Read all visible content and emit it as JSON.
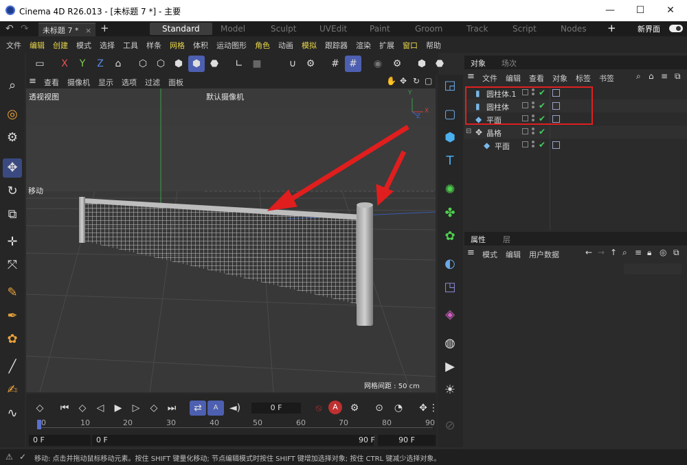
{
  "window": {
    "title": "Cinema 4D R26.013 - [未标题 7 *] - 主要",
    "btn_minimize": "—",
    "btn_maximize": "☐",
    "btn_close": "✕"
  },
  "tabbar": {
    "doc_tab": "未标题 7 *",
    "doc_close": "×",
    "new_tab": "+",
    "layouts": [
      "Standard",
      "Model",
      "Sculpt",
      "UVEdit",
      "Paint",
      "Groom",
      "Track",
      "Script",
      "Nodes"
    ],
    "active_layout": "Standard",
    "add_layout": "+",
    "new_interface": "新界面"
  },
  "menubar": {
    "items": [
      "文件",
      "编辑",
      "创建",
      "模式",
      "选择",
      "工具",
      "样条",
      "网格",
      "体积",
      "运动图形",
      "角色",
      "动画",
      "模拟",
      "跟踪器",
      "渲染",
      "扩展",
      "窗口",
      "帮助"
    ],
    "highlighted": [
      "编辑",
      "创建",
      "网格",
      "角色",
      "模拟",
      "窗口"
    ]
  },
  "toolbar": {
    "x_label": "X",
    "y_label": "Y",
    "z_label": "Z"
  },
  "viewport": {
    "menu": [
      "查看",
      "摄像机",
      "显示",
      "选项",
      "过滤",
      "面板"
    ],
    "view_name": "透视视图",
    "camera_name": "默认摄像机",
    "move_label": "移动",
    "grid_spacing": "网格间距 : 50 cm",
    "axis_y": "Y",
    "axis_x": "X",
    "axis_z": "Z"
  },
  "timeline": {
    "current_frame": "0 F",
    "ticks": [
      "0",
      "10",
      "20",
      "30",
      "40",
      "50",
      "60",
      "70",
      "80",
      "90"
    ],
    "start_field": "0 F",
    "min_field": "0 F",
    "end_field": "90 F",
    "max_field": "90 F",
    "autokey_label": "A"
  },
  "object_manager": {
    "tabs": [
      "对象",
      "场次"
    ],
    "active_tab": "对象",
    "menu": [
      "文件",
      "编辑",
      "查看",
      "对象",
      "标签",
      "书签"
    ],
    "objects": [
      {
        "name": "圆柱体.1",
        "icon": "cylinder-icon"
      },
      {
        "name": "圆柱体",
        "icon": "cylinder-icon"
      },
      {
        "name": "平面",
        "icon": "plane-icon"
      },
      {
        "name": "晶格",
        "icon": "lattice-icon"
      },
      {
        "name": "平面",
        "icon": "plane-icon"
      }
    ]
  },
  "attribute_manager": {
    "tabs": [
      "属性",
      "层"
    ],
    "active_tab": "属性",
    "menu": [
      "模式",
      "编辑",
      "用户数据"
    ]
  },
  "status": {
    "text": "移动: 点击并拖动鼠标移动元素。按住 SHIFT 键量化移动; 节点编辑模式时按住 SHIFT 键增加选择对象; 按住 CTRL 键减少选择对象。"
  },
  "colors": {
    "accent": "#4d5fb0",
    "highlight_menu": "#e8d64a",
    "annotation_red": "#e02020",
    "check_green": "#43d05c"
  }
}
